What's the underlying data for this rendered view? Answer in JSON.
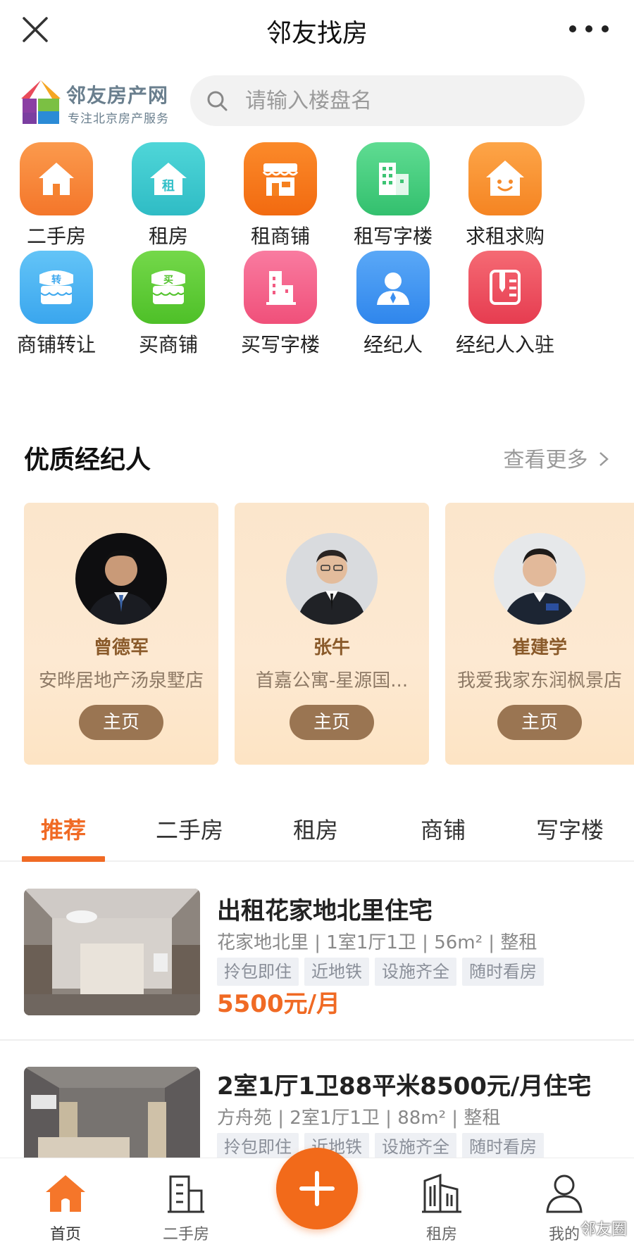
{
  "header": {
    "title": "邻友找房"
  },
  "brand": {
    "name": "邻友房产网",
    "slogan": "专注北京房产服务"
  },
  "search": {
    "placeholder": "请输入楼盘名"
  },
  "categories": [
    {
      "label": "二手房",
      "icon": "house-icon",
      "color": "#f78a3b"
    },
    {
      "label": "租房",
      "icon": "rent-house-icon",
      "color": "#3fc9cf"
    },
    {
      "label": "租商铺",
      "icon": "shop-icon",
      "color": "#f77a1e"
    },
    {
      "label": "租写字楼",
      "icon": "office-building-icon",
      "color": "#42cc7e"
    },
    {
      "label": "求租求购",
      "icon": "smile-house-icon",
      "color": "#f8902f"
    },
    {
      "label": "商铺转让",
      "icon": "transfer-shop-icon",
      "color": "#4fb6f2"
    },
    {
      "label": "买商铺",
      "icon": "buy-shop-icon",
      "color": "#5ccc36"
    },
    {
      "label": "买写字楼",
      "icon": "buy-office-icon",
      "color": "#f5638a"
    },
    {
      "label": "经纪人",
      "icon": "agent-icon",
      "color": "#3e8ff0"
    },
    {
      "label": "经纪人入驻",
      "icon": "agent-join-icon",
      "color": "#ee4c5c"
    }
  ],
  "agents_section": {
    "title": "优质经纪人",
    "more": "查看更多"
  },
  "agents": [
    {
      "name": "曾德军",
      "store": "安晔居地产汤泉墅店",
      "button": "主页"
    },
    {
      "name": "张牛",
      "store": "首嘉公寓-星源国...",
      "button": "主页"
    },
    {
      "name": "崔建学",
      "store": "我爱我家东润枫景店",
      "button": "主页"
    }
  ],
  "tabs": [
    {
      "label": "推荐",
      "active": true
    },
    {
      "label": "二手房",
      "active": false
    },
    {
      "label": "租房",
      "active": false
    },
    {
      "label": "商铺",
      "active": false
    },
    {
      "label": "写字楼",
      "active": false
    }
  ],
  "listings": [
    {
      "title": "出租花家地北里住宅",
      "meta": "花家地北里 | 1室1厅1卫 | 56m² | 整租",
      "tags": [
        "拎包即住",
        "近地铁",
        "设施齐全",
        "随时看房"
      ],
      "price": "5500元/月"
    },
    {
      "title": "2室1厅1卫88平米8500元/月住宅",
      "meta": "方舟苑 | 2室1厅1卫 | 88m² | 整租",
      "tags": [
        "拎包即住",
        "近地铁",
        "设施齐全",
        "随时看房"
      ],
      "price": ""
    }
  ],
  "bottom_nav": [
    {
      "label": "首页",
      "icon": "home-icon",
      "active": true
    },
    {
      "label": "二手房",
      "icon": "building-icon",
      "active": false
    },
    {
      "label": "租房",
      "icon": "rent-building-icon",
      "active": false
    },
    {
      "label": "我的",
      "icon": "user-icon",
      "active": false
    }
  ],
  "watermark": "邻友圈",
  "colors": {
    "accent": "#f06a24",
    "agent_button": "#9a7552",
    "agent_card": "#fde6cc"
  }
}
